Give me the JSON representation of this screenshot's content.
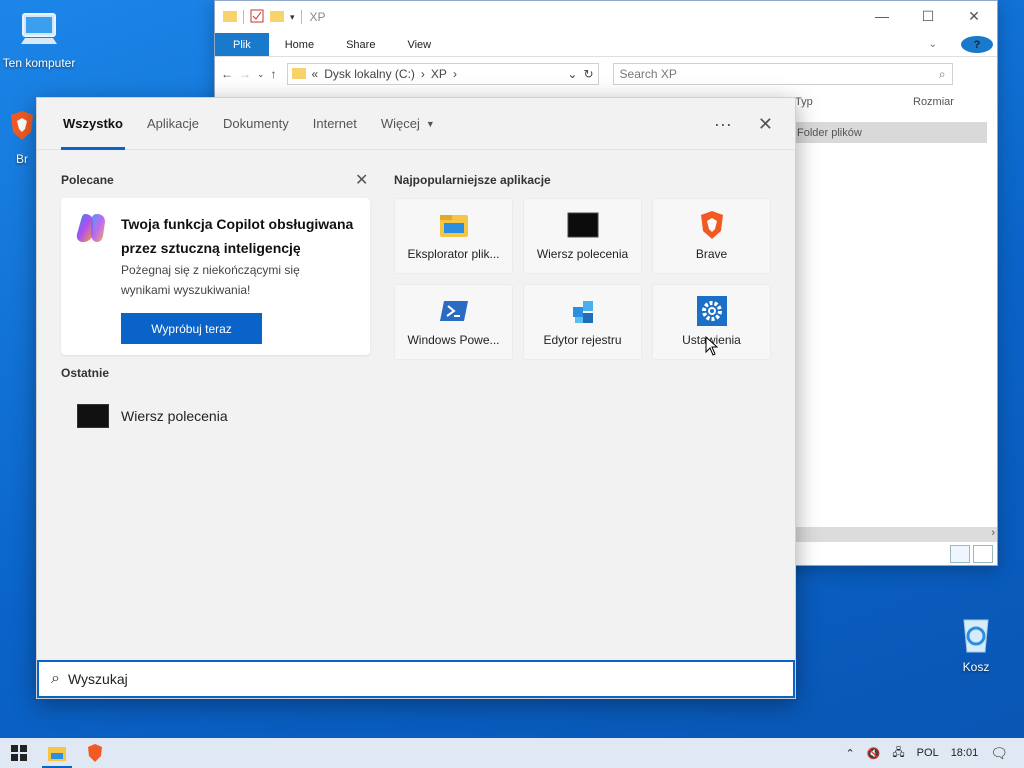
{
  "desktop": {
    "computer_label": "Ten komputer",
    "brave_partial_label": "Br",
    "recycle_label": "Kosz"
  },
  "explorer": {
    "title": "XP",
    "ribbon_tabs": [
      "Plik",
      "Home",
      "Share",
      "View"
    ],
    "breadcrumb": [
      "Dysk lokalny (C:)",
      "XP"
    ],
    "breadcrumb_prefix": "«",
    "search_placeholder": "Search XP",
    "columns": [
      "Typ",
      "Rozmiar"
    ],
    "row_type": "Folder plików",
    "help": "?"
  },
  "search_panel": {
    "tabs": [
      "Wszystko",
      "Aplikacje",
      "Dokumenty",
      "Internet",
      "Więcej"
    ],
    "active_tab": "Wszystko",
    "more_icon": "···",
    "close_icon": "✕",
    "recommended_label": "Polecane",
    "copilot": {
      "title": "Twoja funkcja Copilot obsługiwana przez sztuczną inteligencję",
      "description": "Pożegnaj się z niekończącymi się wynikami wyszukiwania!",
      "button": "Wypróbuj teraz"
    },
    "top_apps_label": "Najpopularniejsze aplikacje",
    "top_apps": [
      {
        "label": "Eksplorator plik...",
        "icon": "folder-icon"
      },
      {
        "label": "Wiersz polecenia",
        "icon": "cmd-icon"
      },
      {
        "label": "Brave",
        "icon": "brave-icon"
      },
      {
        "label": "Windows Powe...",
        "icon": "powershell-icon"
      },
      {
        "label": "Edytor rejestru",
        "icon": "regedit-icon"
      },
      {
        "label": "Ustawienia",
        "icon": "settings-gear-icon"
      }
    ],
    "recent_label": "Ostatnie",
    "recent": [
      {
        "label": "Wiersz polecenia",
        "icon": "cmd-icon"
      }
    ],
    "search_value": "Wyszukaj"
  },
  "taskbar": {
    "language": "POL",
    "time": "18:01"
  },
  "colors": {
    "accent": "#0a63c8",
    "desktop": "#0a6fd6"
  }
}
